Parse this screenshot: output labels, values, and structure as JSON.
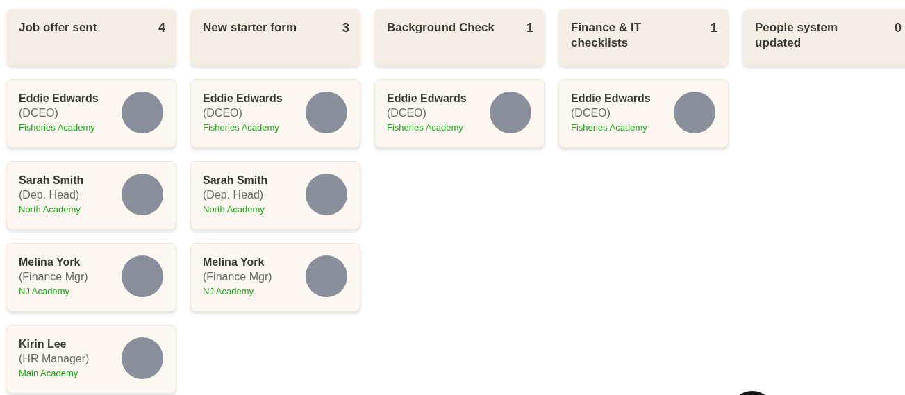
{
  "columns": [
    {
      "title": "Job offer sent",
      "count": "4",
      "cards": [
        {
          "name": "Eddie Edwards",
          "role": "(DCEO)",
          "school": "Fisheries Academy"
        },
        {
          "name": "Sarah Smith",
          "role": "(Dep. Head)",
          "school": "North Academy"
        },
        {
          "name": "Melina York",
          "role": "(Finance Mgr)",
          "school": "NJ Academy"
        },
        {
          "name": "Kirin Lee",
          "role": "(HR Manager)",
          "school": "Main Academy"
        }
      ]
    },
    {
      "title": "New starter form",
      "count": "3",
      "cards": [
        {
          "name": "Eddie Edwards",
          "role": "(DCEO)",
          "school": "Fisheries Academy"
        },
        {
          "name": "Sarah Smith",
          "role": "(Dep. Head)",
          "school": "North Academy"
        },
        {
          "name": "Melina York",
          "role": "(Finance Mgr)",
          "school": "NJ Academy"
        }
      ]
    },
    {
      "title": "Background Check",
      "count": "1",
      "cards": [
        {
          "name": "Eddie Edwards",
          "role": "(DCEO)",
          "school": "Fisheries Academy"
        }
      ]
    },
    {
      "title": "Finance & IT checklists",
      "count": "1",
      "cards": [
        {
          "name": "Eddie Edwards",
          "role": "(DCEO)",
          "school": "Fisheries Academy"
        }
      ]
    },
    {
      "title": "People system updated",
      "count": "0"
    }
  ]
}
